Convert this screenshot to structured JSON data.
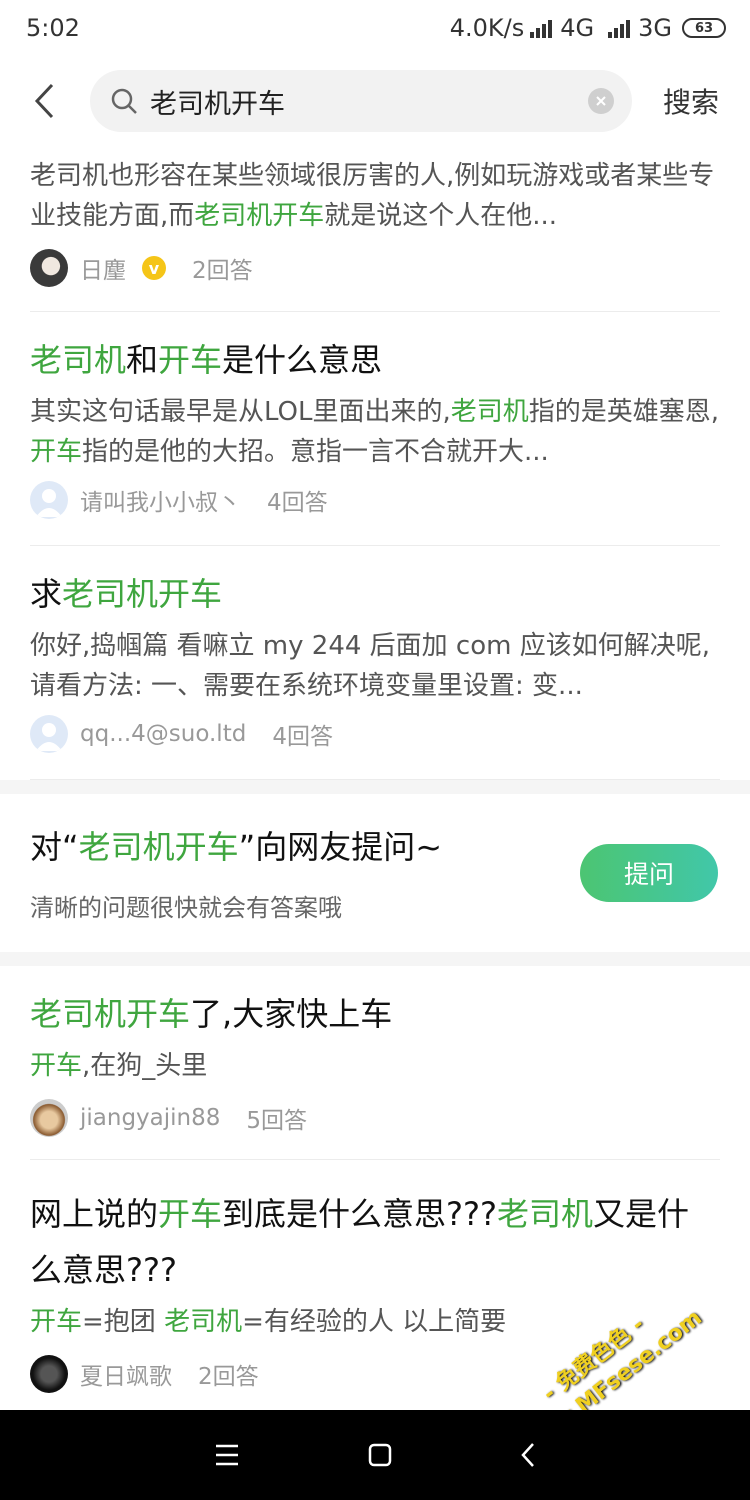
{
  "status_bar": {
    "time": "5:02",
    "net_speed": "4.0K/s",
    "net1": "4G",
    "net2": "3G",
    "battery": "63"
  },
  "search": {
    "query": "老司机开车",
    "placeholder": "",
    "action_label": "搜索"
  },
  "results": [
    {
      "title_parts": [],
      "snippet_parts": [
        {
          "text": "老司机也形容在某些领域很厉害的人,例如玩游戏或者某些专业技能方面,而",
          "hl": false
        },
        {
          "text": "老司机开车",
          "hl": true
        },
        {
          "text": "就是说这个人在他...",
          "hl": false
        }
      ],
      "author": "日麈",
      "answers": "2回答"
    },
    {
      "title_parts": [
        {
          "text": "老司机",
          "hl": true
        },
        {
          "text": "和",
          "hl": false
        },
        {
          "text": "开车",
          "hl": true
        },
        {
          "text": "是什么意思",
          "hl": false
        }
      ],
      "snippet_parts": [
        {
          "text": "其实这句话最早是从LOL里面出来的,",
          "hl": false
        },
        {
          "text": "老司机",
          "hl": true
        },
        {
          "text": "指的是英雄塞恩,",
          "hl": false
        },
        {
          "text": "开车",
          "hl": true
        },
        {
          "text": "指的是他的大招。意指一言不合就开大...",
          "hl": false
        }
      ],
      "author": "请叫我小小叔丶",
      "answers": "4回答"
    },
    {
      "title_parts": [
        {
          "text": "求",
          "hl": false
        },
        {
          "text": "老司机开车",
          "hl": true
        }
      ],
      "snippet_parts": [
        {
          "text": "你好,捣帼篇 看嘛立 my 244 后面加 com 应该如何解决呢,请看方法: 一、需要在系统环境变量里设置: 变...",
          "hl": false
        }
      ],
      "author": "qq...4@suo.ltd",
      "answers": "4回答"
    },
    {
      "title_parts": [
        {
          "text": "老司机开车",
          "hl": true
        },
        {
          "text": "了,大家快上车",
          "hl": false
        }
      ],
      "snippet_parts": [
        {
          "text": "开车",
          "hl": true
        },
        {
          "text": ",在狗_头里",
          "hl": false
        }
      ],
      "author": "jiangyajin88",
      "answers": "5回答"
    },
    {
      "title_parts": [
        {
          "text": "网上说的",
          "hl": false
        },
        {
          "text": "开车",
          "hl": true
        },
        {
          "text": "到底是什么意思???",
          "hl": false
        },
        {
          "text": "老司机",
          "hl": true
        },
        {
          "text": "又是什么意思???",
          "hl": false
        }
      ],
      "snippet_parts": [
        {
          "text": "开车",
          "hl": true
        },
        {
          "text": "=抱团 ",
          "hl": false
        },
        {
          "text": "老司机",
          "hl": true
        },
        {
          "text": "=有经验的人 以上简要",
          "hl": false
        }
      ],
      "author": "夏日飒歌",
      "answers": "2回答"
    }
  ],
  "ask": {
    "title_prefix": "对“",
    "title_keyword": "老司机开车",
    "title_suffix": "”向网友提问~",
    "subtitle": "清晰的问题很快就会有答案哦",
    "button_label": "提问"
  },
  "watermark": {
    "line1": "- 免费色色 -",
    "line2": "www.MFsese.com"
  },
  "colors": {
    "highlight": "#3fa63f",
    "ask_button_start": "#4cc572",
    "ask_button_end": "#41c7a9",
    "nav_bar": "#000000"
  }
}
